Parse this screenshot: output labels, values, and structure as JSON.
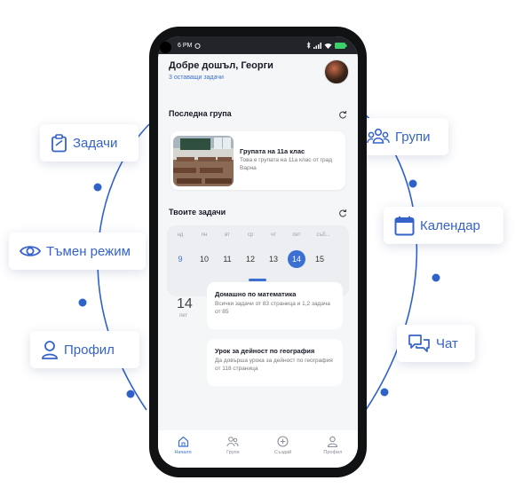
{
  "colors": {
    "accent": "#3b6fd1",
    "pill_text": "#3563c9",
    "orbit": "#2f62c8"
  },
  "features": [
    {
      "label": "Задачи",
      "icon": "clipboard-icon"
    },
    {
      "label": "Тъмен режим",
      "icon": "eye-icon"
    },
    {
      "label": "Профил",
      "icon": "user-icon"
    },
    {
      "label": "Групи",
      "icon": "group-icon"
    },
    {
      "label": "Календар",
      "icon": "calendar-icon"
    },
    {
      "label": "Чат",
      "icon": "chat-icon"
    }
  ],
  "status_bar": {
    "time": "6 PM"
  },
  "header": {
    "greeting": "Добре дошъл, Георги",
    "tasks_left": "3 оставащи задачи"
  },
  "last_group": {
    "section_title": "Последна група",
    "name": "Групата на 11а клас",
    "description": "Това е групата на 11а клас от град Варна"
  },
  "tasks": {
    "section_title": "Твоите задачи",
    "weekdays": [
      "нд",
      "пн",
      "вт",
      "ср",
      "чт",
      "пет",
      "съб..."
    ],
    "dates": [
      "9",
      "10",
      "11",
      "12",
      "13",
      "14",
      "15"
    ],
    "selected_index": 5,
    "day_number": "14",
    "day_name": "пет",
    "items": [
      {
        "title": "Домашно по математика",
        "description": "Всички задачи от 83 страница и 1,2 задача от 85"
      },
      {
        "title": "Урок за дейност по география",
        "description": "Да довърша урока за дейност по география от 118 страница"
      }
    ]
  },
  "nav": [
    {
      "label": "Начало",
      "icon": "home-icon",
      "active": true
    },
    {
      "label": "Групи",
      "icon": "group-icon",
      "active": false
    },
    {
      "label": "Създай",
      "icon": "plus-circle-icon",
      "active": false
    },
    {
      "label": "Профил",
      "icon": "user-icon",
      "active": false
    }
  ]
}
